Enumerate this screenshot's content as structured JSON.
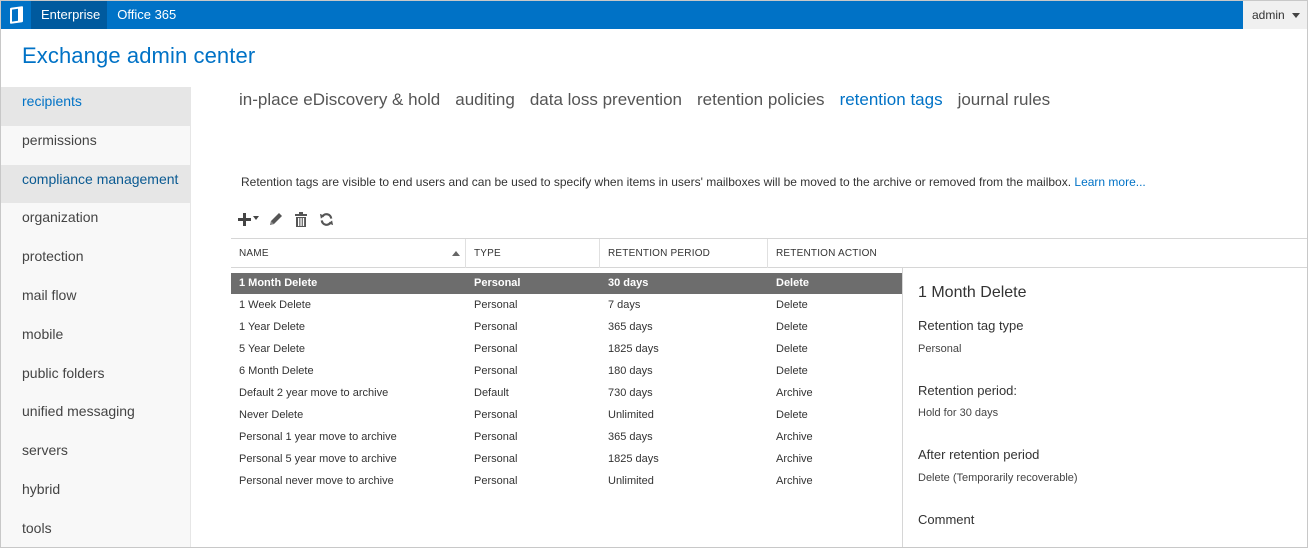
{
  "topbar": {
    "nav": [
      "Enterprise",
      "Office 365"
    ],
    "user": "admin"
  },
  "app_title": "Exchange admin center",
  "leftnav": {
    "items": [
      "recipients",
      "permissions",
      "compliance management",
      "organization",
      "protection",
      "mail flow",
      "mobile",
      "public folders",
      "unified messaging",
      "servers",
      "hybrid",
      "tools"
    ]
  },
  "subtabs": [
    "in-place eDiscovery & hold",
    "auditing",
    "data loss prevention",
    "retention policies",
    "retention tags",
    "journal rules"
  ],
  "description": {
    "text": "Retention tags are visible to end users and can be used to specify when items in users' mailboxes will be moved to the archive or removed from the mailbox.",
    "link": "Learn more..."
  },
  "table": {
    "headers": [
      "NAME",
      "TYPE",
      "RETENTION PERIOD",
      "RETENTION ACTION"
    ],
    "rows": [
      [
        "1 Month Delete",
        "Personal",
        "30 days",
        "Delete"
      ],
      [
        "1 Week Delete",
        "Personal",
        "7 days",
        "Delete"
      ],
      [
        "1 Year Delete",
        "Personal",
        "365 days",
        "Delete"
      ],
      [
        "5 Year Delete",
        "Personal",
        "1825 days",
        "Delete"
      ],
      [
        "6 Month Delete",
        "Personal",
        "180 days",
        "Delete"
      ],
      [
        "Default 2 year move to archive",
        "Default",
        "730 days",
        "Archive"
      ],
      [
        "Never Delete",
        "Personal",
        "Unlimited",
        "Delete"
      ],
      [
        "Personal 1 year move to archive",
        "Personal",
        "365 days",
        "Archive"
      ],
      [
        "Personal 5 year move to archive",
        "Personal",
        "1825 days",
        "Archive"
      ],
      [
        "Personal never move to archive",
        "Personal",
        "Unlimited",
        "Archive"
      ]
    ]
  },
  "detail": {
    "title": "1 Month Delete",
    "type_label": "Retention tag type",
    "type_value": "Personal",
    "period_label": "Retention period:",
    "period_value": "Hold for 30 days",
    "after_label": "After retention period",
    "after_value": "Delete (Temporarily recoverable)",
    "comment_label": "Comment"
  },
  "colors": {
    "brand": "#0072c6",
    "selected_row": "#6d6d6d"
  }
}
